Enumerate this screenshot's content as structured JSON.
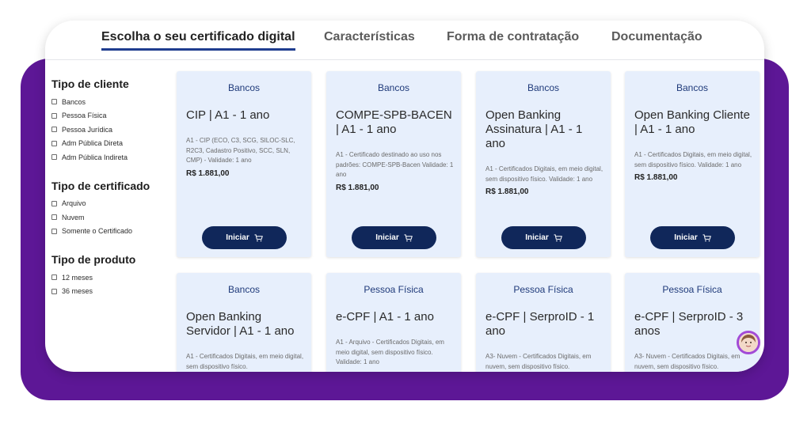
{
  "tabs": [
    {
      "label": "Escolha o seu certificado digital"
    },
    {
      "label": "Características"
    },
    {
      "label": "Forma de contratação"
    },
    {
      "label": "Documentação"
    }
  ],
  "filters": [
    {
      "title": "Tipo de cliente",
      "options": [
        "Bancos",
        "Pessoa Física",
        "Pessoa Jurídica",
        "Adm Pública Direta",
        "Adm Pública Indireta"
      ]
    },
    {
      "title": "Tipo de certificado",
      "options": [
        "Arquivo",
        "Nuvem",
        "Somente o Certificado"
      ]
    },
    {
      "title": "Tipo de produto",
      "options": [
        "12 meses",
        "36 meses"
      ]
    }
  ],
  "cards": [
    {
      "category": "Bancos",
      "title": "CIP | A1 - 1 ano",
      "description": "A1 - CIP (ECO, C3, SCG, SILOC-SLC, R2C3, Cadastro Positivo, SCC, SLN, CMP) - Validade: 1 ano",
      "price": "R$ 1.881,00",
      "button": "Iniciar"
    },
    {
      "category": "Bancos",
      "title": "COMPE-SPB-BACEN | A1 - 1 ano",
      "description": "A1 - Certificado destinado ao uso nos padrões: COMPE-SPB-Bacen Validade: 1 ano",
      "price": "R$ 1.881,00",
      "button": "Iniciar"
    },
    {
      "category": "Bancos",
      "title": "Open Banking Assinatura | A1 - 1 ano",
      "description": "A1 - Certificados Digitais, em meio digital, sem dispositivo físico. Validade: 1 ano",
      "price": "R$ 1.881,00",
      "button": "Iniciar"
    },
    {
      "category": "Bancos",
      "title": "Open Banking Cliente | A1 - 1 ano",
      "description": "A1 - Certificados Digitais, em meio digital, sem dispositivo físico. Validade: 1 ano",
      "price": "R$ 1.881,00",
      "button": "Iniciar"
    },
    {
      "category": "Bancos",
      "title": "Open Banking Servidor | A1 - 1 ano",
      "description": "A1 - Certificados Digitais, em meio digital, sem dispositivo físico.",
      "price": "",
      "button": ""
    },
    {
      "category": "Pessoa Física",
      "title": "e-CPF | A1 - 1 ano",
      "description": "A1 - Arquivo - Certificados Digitais, em meio digital, sem dispositivo físico. Validade: 1 ano",
      "price": "",
      "button": ""
    },
    {
      "category": "Pessoa Física",
      "title": "e-CPF | SerproID - 1 ano",
      "description": "A3- Nuvem - Certificados Digitais, em nuvem, sem dispositivo físico.",
      "price": "",
      "button": ""
    },
    {
      "category": "Pessoa Física",
      "title": "e-CPF | SerproID - 3 anos",
      "description": "A3- Nuvem - Certificados Digitais, em nuvem, sem dispositivo físico.",
      "price": "",
      "button": ""
    }
  ],
  "colors": {
    "accent": "#1f3d8f",
    "button": "#10275a",
    "card": "#e7effc",
    "frame": "#5d1796"
  },
  "icons": {
    "cart": "cart-icon",
    "avatar": "avatar"
  }
}
